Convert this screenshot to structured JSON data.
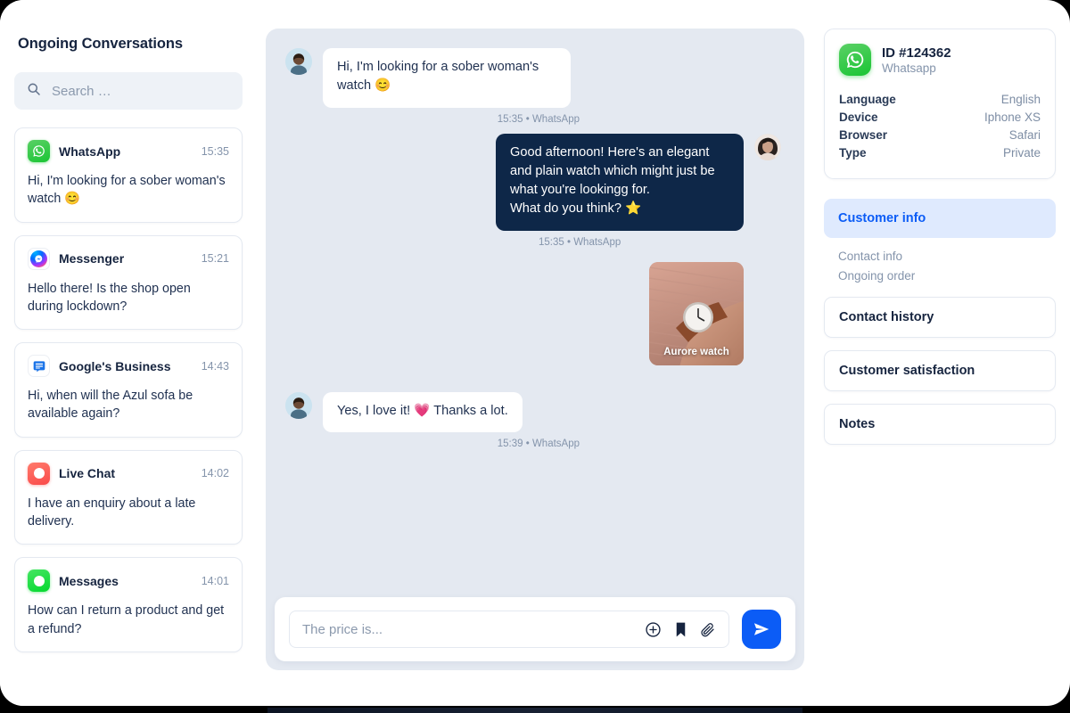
{
  "sidebar": {
    "title": "Ongoing Conversations",
    "search": {
      "placeholder": "Search …",
      "value": "",
      "icon": "search-icon"
    },
    "conversations": [
      {
        "channel": "WhatsApp",
        "icon": "whatsapp-icon",
        "time": "15:35",
        "preview": "Hi, I'm looking for a sober woman's watch 😊"
      },
      {
        "channel": "Messenger",
        "icon": "messenger-icon",
        "time": "15:21",
        "preview": "Hello there! Is the shop open during lockdown?"
      },
      {
        "channel": "Google's Business",
        "icon": "google-business-icon",
        "time": "14:43",
        "preview": "Hi, when will the Azul sofa be available again?"
      },
      {
        "channel": "Live Chat",
        "icon": "live-chat-icon",
        "time": "14:02",
        "preview": "I have an enquiry about a late delivery."
      },
      {
        "channel": "Messages",
        "icon": "messages-icon",
        "time": "14:01",
        "preview": "How can I return a product and get a refund?"
      }
    ]
  },
  "chat": {
    "messages": [
      {
        "direction": "incoming",
        "text": "Hi, I'm looking for a sober woman's watch 😊",
        "meta": "15:35 • WhatsApp",
        "avatar": "customer-avatar"
      },
      {
        "direction": "outgoing",
        "text": "Good afternoon! Here's an elegant and plain watch which might just be what you're lookingg for.",
        "text_line2": "What do you think? ⭐",
        "meta": "15:35 • WhatsApp",
        "avatar": "agent-avatar"
      },
      {
        "direction": "outgoing",
        "type": "product-card",
        "product_label": "Aurore watch"
      },
      {
        "direction": "incoming",
        "text": "Yes, I love it! 💗 Thanks a lot.",
        "meta": "15:39 • WhatsApp",
        "avatar": "customer-avatar"
      }
    ],
    "composer": {
      "placeholder": "The price is...",
      "value": "",
      "icons": [
        "plus-circle-icon",
        "bookmark-icon",
        "paperclip-icon"
      ],
      "send_label": "send-icon"
    }
  },
  "customer_panel": {
    "id_card": {
      "icon": "whatsapp-icon",
      "id": "ID #124362",
      "channel": "Whatsapp",
      "rows": [
        {
          "key": "Language",
          "value": "English"
        },
        {
          "key": "Device",
          "value": "Iphone XS"
        },
        {
          "key": "Browser",
          "value": "Safari"
        },
        {
          "key": "Type",
          "value": "Private"
        }
      ]
    },
    "active_section": "Customer info",
    "sub_links": [
      "Contact info",
      "Ongoing order"
    ],
    "sections": [
      "Contact history",
      "Customer satisfaction",
      "Notes"
    ]
  },
  "colors": {
    "accent": "#0b5cf6",
    "dark_bubble": "#0e2748",
    "chat_bg": "#e4e9f1",
    "whatsapp_green": "#19C533",
    "live_chat_red": "#FA4A4A",
    "text_dark": "#16243f",
    "text_muted": "#8494ab"
  }
}
